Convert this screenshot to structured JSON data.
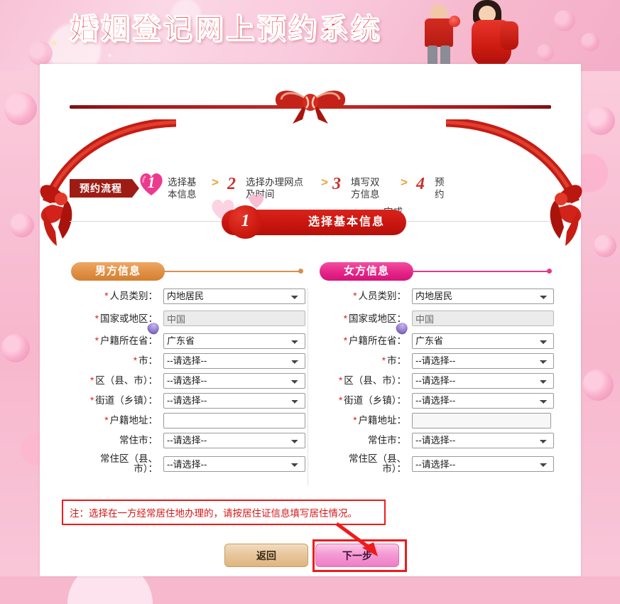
{
  "banner": {
    "title": "婚姻登记网上预约系统"
  },
  "flow": {
    "tag": "预约流程",
    "separator": ">",
    "steps": [
      {
        "num": "1",
        "label": "选择基本信息",
        "line1": "选择基",
        "line2": "本信息",
        "active": true
      },
      {
        "num": "2",
        "label": "选择办理网点及时间",
        "line1": "选择办理网点",
        "line2": "及时间",
        "active": false
      },
      {
        "num": "3",
        "label": "填写双方信息",
        "line1": "填写双",
        "line2": "方信息",
        "active": false
      },
      {
        "num": "4",
        "label": "预约完成",
        "line1": "预",
        "line2": "约",
        "line3": "完成",
        "active": false
      }
    ]
  },
  "step_banner": {
    "number": "1",
    "title": "选择基本信息"
  },
  "sections": {
    "male": {
      "title": "男方信息",
      "color": "#e08f44"
    },
    "female": {
      "title": "女方信息",
      "color": "#e62487"
    }
  },
  "placeholder_select": "--请选择--",
  "male_form": {
    "fields": [
      {
        "label": "人员类别：",
        "required": true,
        "type": "select",
        "value": "内地居民"
      },
      {
        "label": "国家或地区：",
        "required": true,
        "type": "readonly",
        "value": "中国"
      },
      {
        "label": "户籍所在省：",
        "required": true,
        "type": "select",
        "value": "广东省"
      },
      {
        "label": "市：",
        "required": true,
        "type": "select",
        "value": "--请选择--"
      },
      {
        "label": "区（县、市）：",
        "required": true,
        "type": "select",
        "value": "--请选择--"
      },
      {
        "label": "街道（乡镇）：",
        "required": true,
        "type": "select",
        "value": "--请选择--"
      },
      {
        "label": "户籍地址：",
        "required": true,
        "type": "text",
        "value": ""
      },
      {
        "label": "常住市：",
        "required": false,
        "type": "select",
        "value": "--请选择--"
      },
      {
        "label": "常住区（县、市）：",
        "required": false,
        "type": "select",
        "value": "--请选择--"
      }
    ]
  },
  "female_form": {
    "fields": [
      {
        "label": "人员类别：",
        "required": true,
        "type": "select",
        "value": "内地居民"
      },
      {
        "label": "国家或地区：",
        "required": true,
        "type": "readonly",
        "value": "中国"
      },
      {
        "label": "户籍所在省：",
        "required": true,
        "type": "select",
        "value": "广东省"
      },
      {
        "label": "市：",
        "required": true,
        "type": "select",
        "value": "--请选择--"
      },
      {
        "label": "区（县、市）：",
        "required": true,
        "type": "select",
        "value": "--请选择--"
      },
      {
        "label": "街道（乡镇）：",
        "required": true,
        "type": "select",
        "value": "--请选择--"
      },
      {
        "label": "户籍地址：",
        "required": true,
        "type": "text",
        "value": ""
      },
      {
        "label": "常住市：",
        "required": false,
        "type": "select",
        "value": "--请选择--"
      },
      {
        "label": "常住区（县、市）：",
        "required": false,
        "type": "select",
        "value": "--请选择--"
      }
    ]
  },
  "note": {
    "text": "注：选择在一方经常居住地办理的，请按居住证信息填写居住情况。",
    "color": "#d81515"
  },
  "buttons": {
    "back": "返回",
    "next": "下一步"
  },
  "annotation": {
    "highlight_color": "#ee1b1b",
    "target": "下一步"
  }
}
